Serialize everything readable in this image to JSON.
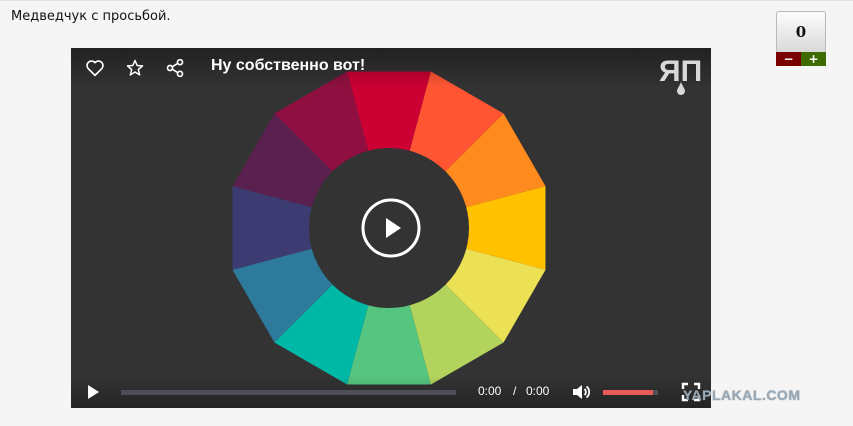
{
  "post": {
    "text": "Медведчук с просьбой."
  },
  "rating": {
    "value": "0",
    "minus_label": "−",
    "plus_label": "+",
    "colors": {
      "minus": "#7a0000",
      "plus": "#3d6b00"
    }
  },
  "player": {
    "title": "Ну собственно вот!",
    "top_icons": [
      "heart-icon",
      "star-icon",
      "share-icon"
    ],
    "logo_text": "ЯП",
    "current_time": "0:00",
    "time_separator": "/",
    "duration": "0:00",
    "progress": 0,
    "volume": 0.9,
    "accent_color": "#e85a58",
    "wheel_colors": [
      "#cc0033",
      "#ff5533",
      "#ff8a1d",
      "#ffc100",
      "#ece054",
      "#b2d45d",
      "#55c57f",
      "#00b8a6",
      "#2e7a9c",
      "#3c3c72",
      "#5a2050",
      "#8f1040"
    ]
  },
  "watermark": {
    "text": "YAPLAKAL.COM"
  }
}
